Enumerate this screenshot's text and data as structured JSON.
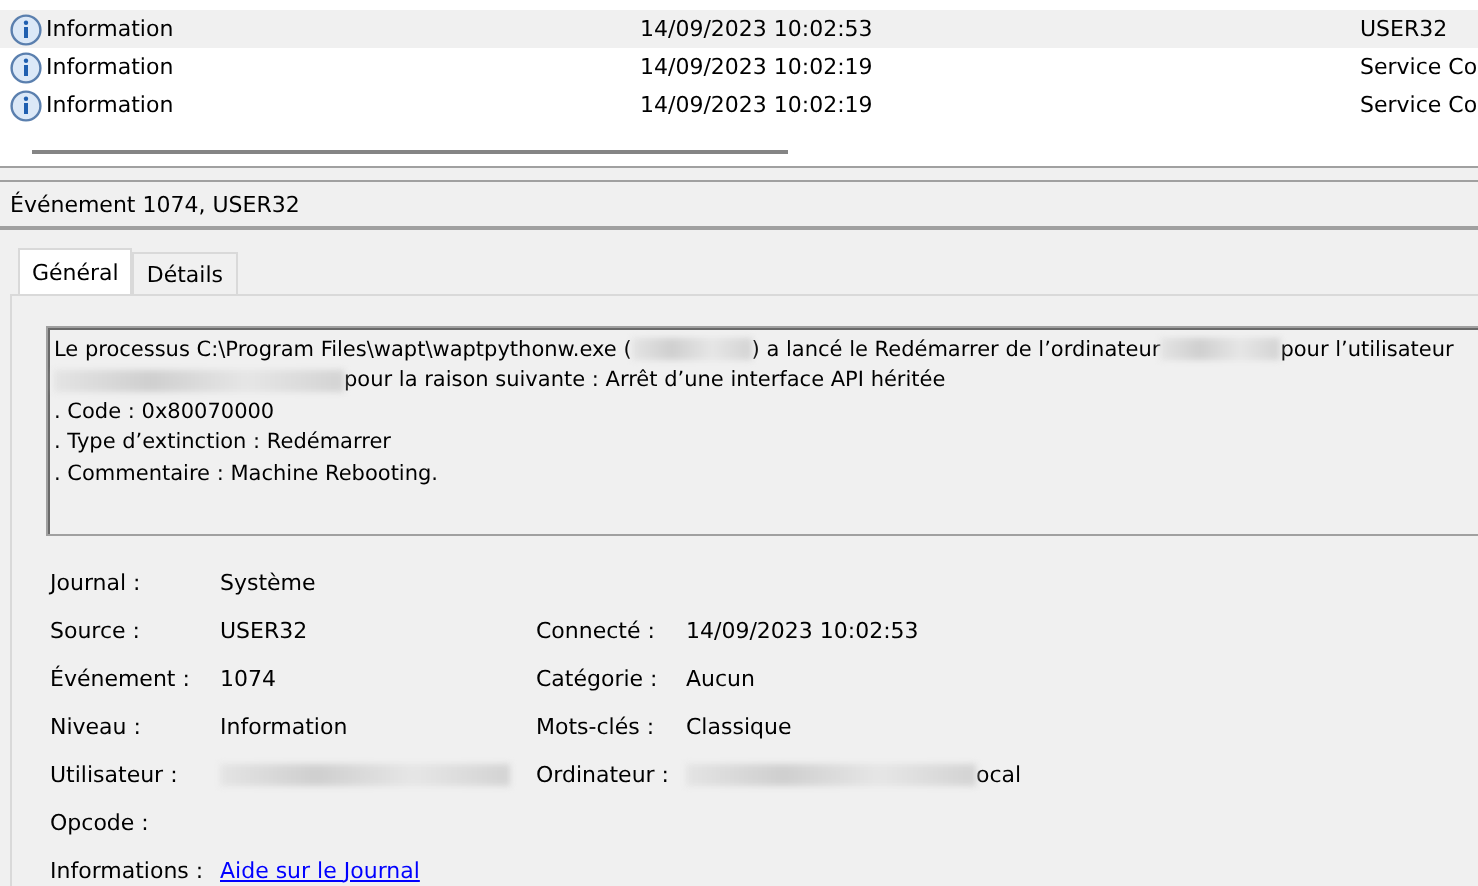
{
  "events": [
    {
      "level": "Information",
      "date": "14/09/2023 10:02:53",
      "source": "USER32",
      "selected": true
    },
    {
      "level": "Information",
      "date": "14/09/2023 10:02:19",
      "source": "Service Co",
      "selected": false
    },
    {
      "level": "Information",
      "date": "14/09/2023 10:02:19",
      "source": "Service Co",
      "selected": false
    }
  ],
  "detail_title": "Événement 1074, USER32",
  "tabs": [
    {
      "label": "Général",
      "selected": true
    },
    {
      "label": "Détails",
      "selected": false
    }
  ],
  "message_lines": [
    [
      {
        "kind": "text",
        "text": "Le processus C:\\Program Files\\wapt\\waptpythonw.exe ("
      },
      {
        "kind": "blur_short"
      },
      {
        "kind": "text",
        "text": ") a lancé le Redémarrer de l’ordinateur "
      },
      {
        "kind": "blur_short"
      },
      {
        "kind": "text",
        "text": "pour l’utilisateur"
      }
    ],
    [
      {
        "kind": "blur_long"
      },
      {
        "kind": "text",
        "text": "pour la raison suivante : Arrêt d’une interface API héritée"
      }
    ],
    [
      {
        "kind": "text",
        "text": ".  Code : 0x80070000"
      }
    ],
    [
      {
        "kind": "text",
        "text": ".  Type d’extinction : Redémarrer"
      }
    ],
    [
      {
        "kind": "text",
        "text": ".  Commentaire : Machine Rebooting."
      }
    ]
  ],
  "properties": [
    {
      "left": {
        "label": "Journal :",
        "value": [
          {
            "kind": "text",
            "text": "Système"
          }
        ]
      }
    },
    {
      "left": {
        "label": "Source :",
        "value": [
          {
            "kind": "text",
            "text": "USER32"
          }
        ]
      },
      "right": {
        "label": "Connecté :",
        "value": [
          {
            "kind": "text",
            "text": "14/09/2023 10:02:53"
          }
        ]
      }
    },
    {
      "left": {
        "label": "Événement :",
        "value": [
          {
            "kind": "text",
            "text": "1074"
          }
        ]
      },
      "right": {
        "label": "Catégorie :",
        "value": [
          {
            "kind": "text",
            "text": "Aucun"
          }
        ]
      }
    },
    {
      "left": {
        "label": "Niveau :",
        "value": [
          {
            "kind": "text",
            "text": "Information"
          }
        ]
      },
      "right": {
        "label": "Mots-clés :",
        "value": [
          {
            "kind": "text",
            "text": "Classique"
          }
        ]
      }
    },
    {
      "left": {
        "label": "Utilisateur :",
        "value": [
          {
            "kind": "blur_long"
          }
        ]
      },
      "right": {
        "label": "Ordinateur :",
        "value": [
          {
            "kind": "blur_long"
          },
          {
            "kind": "text",
            "text": "ocal"
          }
        ]
      }
    },
    {
      "left": {
        "label": "Opcode :"
      }
    },
    {
      "left": {
        "label": "Informations :",
        "value": [
          {
            "kind": "link",
            "text": "Aide sur le Journal"
          }
        ]
      }
    }
  ]
}
